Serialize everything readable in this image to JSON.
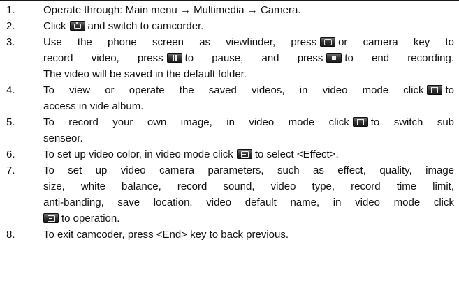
{
  "items": [
    {
      "num": "1.",
      "parts": [
        "Operate through: Main menu → Multimedia → Camera."
      ]
    },
    {
      "num": "2.",
      "parts": [
        "Click",
        "and switch to camcorder."
      ]
    },
    {
      "num": "3.",
      "parts": [
        "Use the phone screen as viewfinder, press",
        "or camera key to",
        "record video, press",
        "to pause, and press",
        "to end recording.",
        "The video will be saved in the default folder."
      ]
    },
    {
      "num": "4.",
      "parts": [
        "To view or operate the saved videos, in video mode click",
        "to",
        "access in vide album."
      ]
    },
    {
      "num": "5.",
      "parts": [
        "To record your own image, in video mode click",
        "to switch sub",
        "senseor."
      ]
    },
    {
      "num": "6.",
      "parts": [
        "To set up video color, in video mode click",
        "to select <Effect>."
      ]
    },
    {
      "num": "7.",
      "parts": [
        "To set up video camera parameters, such as effect, quality, image",
        "size, white balance, record sound, video type, record time limit,",
        "anti-banding, save location, video default name, in video mode click",
        "to operation."
      ]
    },
    {
      "num": "8.",
      "parts": [
        "To exit camcoder, press <End> key to back previous."
      ]
    }
  ],
  "icons": {
    "camcorder_switch": "camcorder-switch-icon",
    "record": "record-icon",
    "pause": "pause-icon",
    "stop": "stop-icon",
    "album": "album-icon",
    "sub_sensor": "sub-sensor-icon",
    "effect": "effect-menu-icon",
    "settings": "settings-menu-icon"
  }
}
